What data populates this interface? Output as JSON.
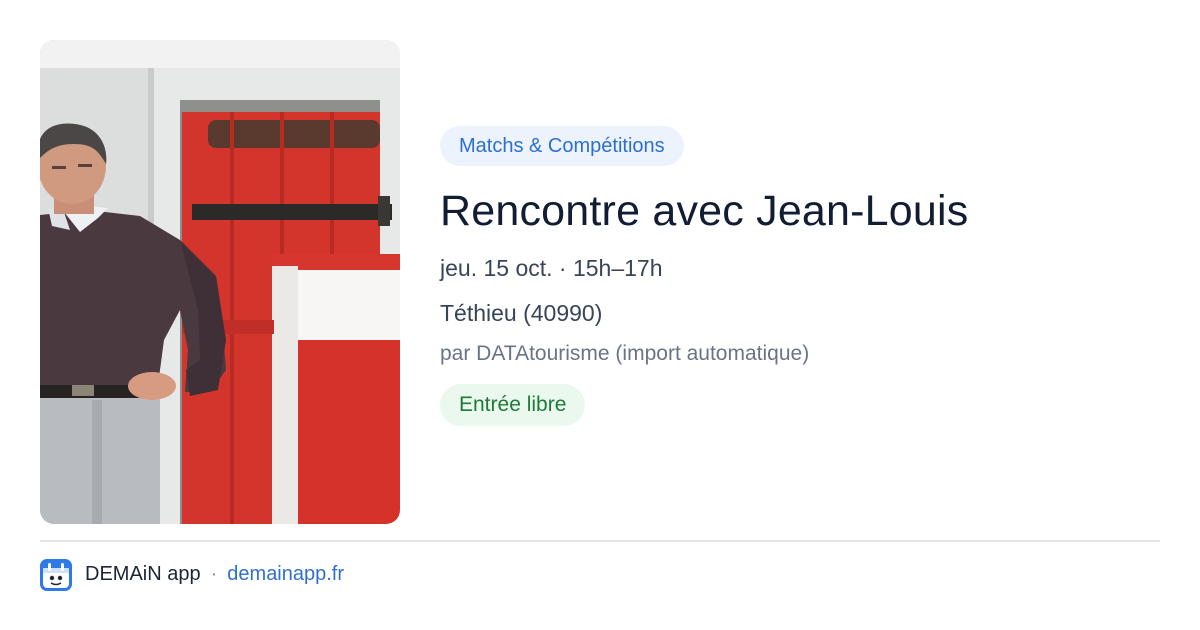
{
  "event": {
    "category": "Matchs & Compétitions",
    "title": "Rencontre avec Jean-Louis",
    "datetime": "jeu. 15 oct. · 15h–17h",
    "location": "Téthieu (40990)",
    "source": "par DATAtourisme (import automatique)",
    "price": "Entrée libre"
  },
  "footer": {
    "app_name": "DEMAiN app",
    "separator": "·",
    "url": "demainapp.fr"
  },
  "colors": {
    "category_bg": "#edf3fd",
    "category_text": "#2d6fd1",
    "price_bg": "#ebf8ee",
    "price_text": "#1f7a3a",
    "link": "#2f6fcf",
    "title": "#121c33"
  },
  "icons": {
    "app": "demain-app-icon"
  }
}
